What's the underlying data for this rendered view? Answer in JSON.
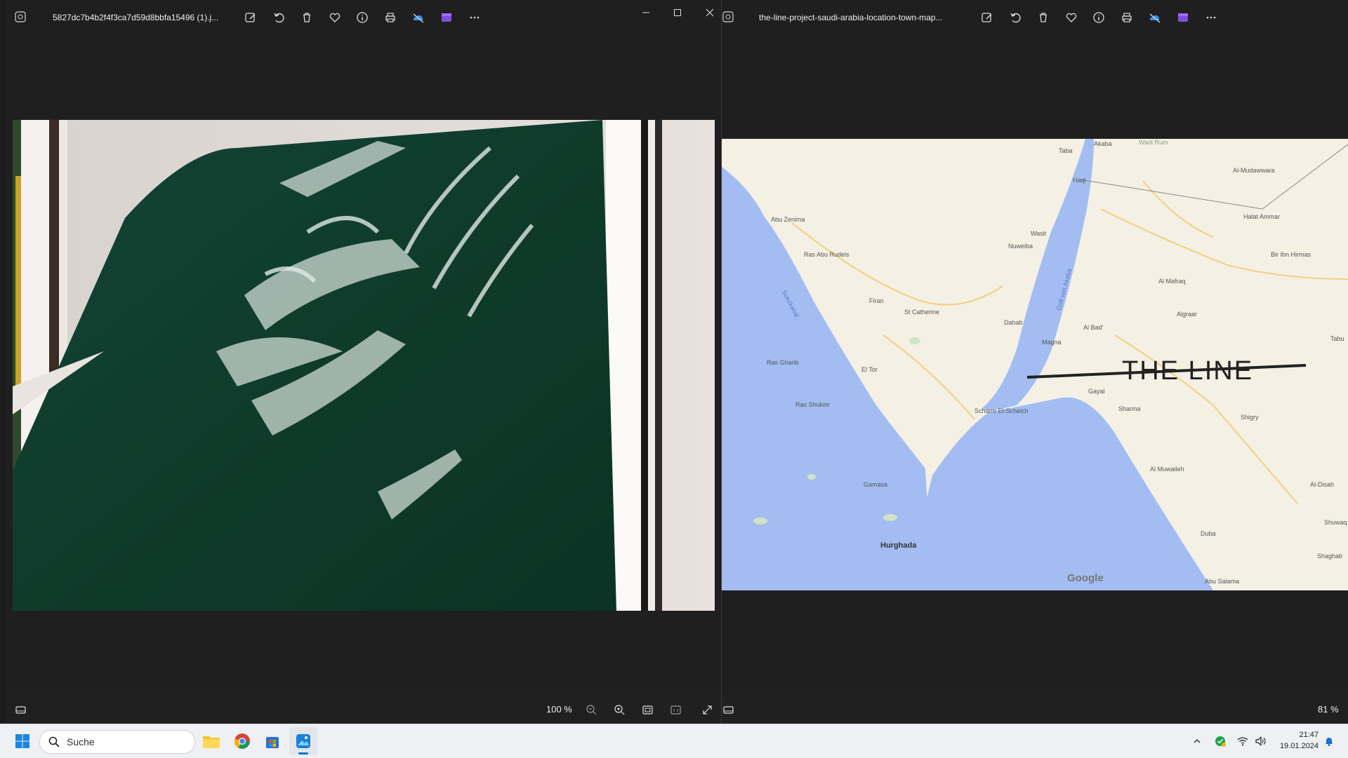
{
  "left_window": {
    "filename": "5827dc7b4b2f4f3ca7d59d8bbfa15496 (1).j...",
    "zoom": "100 %",
    "toolbar_icons": [
      "edit-icon",
      "rotate-icon",
      "delete-icon",
      "favorite-icon",
      "info-icon",
      "print-icon",
      "onedrive-icon",
      "clipchamp-icon",
      "more-icon"
    ]
  },
  "right_window": {
    "filename": "the-line-project-saudi-arabia-location-town-map...",
    "zoom": "81 %",
    "map": {
      "overlay_title": "THE LINE",
      "attribution": "Google",
      "labels": {
        "akaba": "Akaba",
        "taba": "Taba",
        "wadi_rum": "Wadi Rum",
        "al_mudawwara": "Al-Mudawwara",
        "haql": "Haql",
        "halat_ammar": "Halat Ammar",
        "bir_ibn_hirmas": "Bir Ibn Hirmas",
        "abu_zenima": "Abu Zenima",
        "ras_abu_rudeis": "Ras Abu Rudeis",
        "wasit": "Wasit",
        "nuweiba": "Nuweiba",
        "al_mafraq": "Al Mafraq",
        "firan": "Firan",
        "st_catherine": "St Catherine",
        "dahab": "Dahab",
        "algraar": "Algraar",
        "al_bad": "Al Bad'",
        "magna": "Magna",
        "ras_gharib": "Ras Gharib",
        "el_tor": "El Tor",
        "tabuk": "Tabu",
        "gayal": "Gayal",
        "sharma": "Sharma",
        "ras_shukeir": "Ras Shukeir",
        "scharm": "Scharm El-Scheich",
        "shigry": "Shigry",
        "al_muwaileh": "Al Muwaileh",
        "gamasa": "Gamasa",
        "al_disah": "Al-Disah",
        "shuwaq": "Shuwaq",
        "hurghada": "Hurghada",
        "duba": "Duba",
        "shaghab": "Shaghab",
        "abu_salama": "Abu Salama",
        "gulf_suez": "Suezkanal",
        "gulf_aqaba": "Golf von Akaba"
      }
    }
  },
  "taskbar": {
    "search_placeholder": "Suche",
    "time": "21:47",
    "date": "19.01.2024"
  },
  "colors": {
    "window_bg": "#1f1f1f",
    "flag_green": "#0f3b2b",
    "sea_blue": "#a3bdf2",
    "land": "#f4f0e4",
    "accent": "#0078d4"
  }
}
